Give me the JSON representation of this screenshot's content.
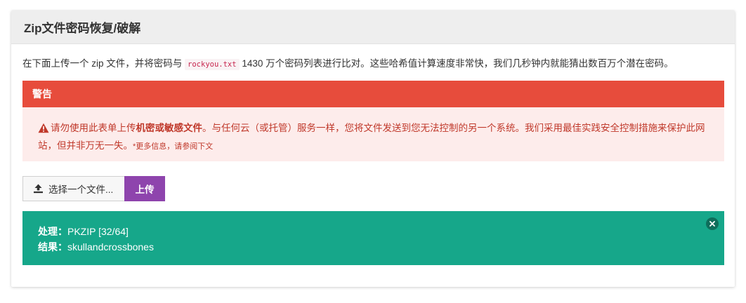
{
  "header": {
    "title": "Zip文件密码恢复/破解"
  },
  "intro": {
    "before": "在下面上传一个 zip 文件，并将密码与",
    "code": "rockyou.txt",
    "after": "1430 万个密码列表进行比对。这些哈希值计算速度非常快，我们几秒钟内就能猜出数百万个潜在密码。"
  },
  "warning": {
    "heading": "警告",
    "text_1": "请勿使用此表单上传",
    "text_bold": "机密或敏感文件",
    "text_2": "。与任何云（或托管）服务一样，您将文件发送到您无法控制的另一个系统。我们采用最佳实践安全控制措施来保护此网站，但并非万无一失。",
    "note": "*更多信息，请参阅下文"
  },
  "upload": {
    "choose_label": "选择一个文件...",
    "upload_label": "上传"
  },
  "result": {
    "process_label": "处理：",
    "process_value": "PKZIP [32/64]",
    "result_label": "结果：",
    "result_value": "skullandcrossbones"
  },
  "icons": {
    "warning": "warning-triangle-icon",
    "upload": "upload-arrow-icon",
    "close": "close-circle-icon"
  },
  "colors": {
    "danger": "#e74c3c",
    "danger_light": "#fdeceb",
    "danger_text": "#c0392b",
    "primary": "#8e44ad",
    "success": "#16a78a"
  }
}
